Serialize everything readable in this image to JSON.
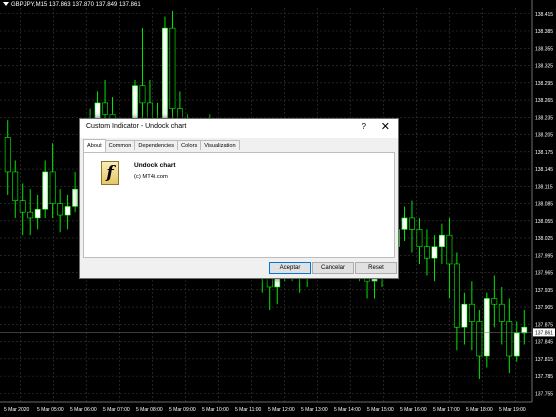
{
  "window": {
    "symbol_info": "GBPJPY,M15  137.863 137.870 137.849 137.861"
  },
  "colors": {
    "bull": "#ffffff",
    "bear": "#000000",
    "wick": "#00ff00",
    "grid": "#3a3a3a",
    "axis_text": "#ffffff",
    "price_tag_bg": "#ffffff",
    "price_tag_text": "#000000"
  },
  "chart_data": {
    "type": "candlestick",
    "symbol": "GBPJPY",
    "timeframe": "M15",
    "price_ticks": [
      "138.415",
      "138.385",
      "138.355",
      "138.325",
      "138.295",
      "138.265",
      "138.235",
      "138.205",
      "138.175",
      "138.145",
      "138.115",
      "138.085",
      "138.055",
      "138.025",
      "137.995",
      "137.965",
      "137.935",
      "137.905",
      "137.875",
      "137.845",
      "137.815",
      "137.785",
      "137.755"
    ],
    "current_price": "137.861",
    "time_ticks": [
      "5 Mar 2020",
      "5 Mar 05:00",
      "5 Mar 06:00",
      "5 Mar 07:00",
      "5 Mar 08:00",
      "5 Mar 09:00",
      "5 Mar 10:00",
      "5 Mar 11:00",
      "5 Mar 12:00",
      "5 Mar 13:00",
      "5 Mar 14:00",
      "5 Mar 15:00",
      "5 Mar 16:00",
      "5 Mar 17:00",
      "5 Mar 18:00",
      "5 Mar 19:00"
    ],
    "ylim": [
      137.74,
      138.425
    ],
    "candles": [
      [
        138.2,
        138.23,
        138.14,
        138.1
      ],
      [
        138.14,
        138.16,
        138.09,
        138.06
      ],
      [
        138.09,
        138.12,
        138.07,
        138.03
      ],
      [
        138.07,
        138.11,
        138.06,
        138.03
      ],
      [
        138.06,
        138.1,
        138.075,
        138.04
      ],
      [
        138.075,
        138.16,
        138.14,
        138.06
      ],
      [
        138.14,
        138.19,
        138.085,
        138.06
      ],
      [
        138.085,
        138.11,
        138.065,
        138.035
      ],
      [
        138.065,
        138.1,
        138.08,
        138.04
      ],
      [
        138.08,
        138.14,
        138.11,
        138.07
      ],
      [
        138.11,
        138.22,
        138.2,
        138.09
      ],
      [
        138.2,
        138.25,
        138.23,
        138.17
      ],
      [
        138.23,
        138.28,
        138.26,
        138.2
      ],
      [
        138.26,
        138.3,
        138.24,
        138.21
      ],
      [
        138.24,
        138.27,
        138.18,
        138.15
      ],
      [
        138.18,
        138.2,
        138.15,
        138.12
      ],
      [
        138.15,
        138.19,
        138.14,
        138.11
      ],
      [
        138.14,
        138.3,
        138.29,
        138.12
      ],
      [
        138.29,
        138.39,
        138.26,
        138.22
      ],
      [
        138.26,
        138.3,
        138.21,
        138.18
      ],
      [
        138.21,
        138.26,
        138.23,
        138.17
      ],
      [
        138.23,
        138.41,
        138.39,
        138.2
      ],
      [
        138.39,
        138.42,
        138.25,
        138.2
      ],
      [
        138.25,
        138.28,
        138.21,
        138.18
      ],
      [
        138.21,
        138.24,
        138.18,
        138.15
      ],
      [
        138.18,
        138.21,
        138.16,
        138.13
      ],
      [
        138.16,
        138.2,
        138.19,
        138.14
      ],
      [
        138.19,
        138.24,
        138.2,
        138.16
      ],
      [
        138.2,
        138.22,
        138.15,
        138.12
      ],
      [
        138.15,
        138.19,
        138.17,
        138.12
      ],
      [
        138.17,
        138.2,
        138.13,
        138.1
      ],
      [
        138.13,
        138.16,
        138.09,
        138.06
      ],
      [
        138.09,
        138.12,
        138.07,
        138.04
      ],
      [
        138.07,
        138.1,
        138.05,
        138.02
      ],
      [
        138.05,
        138.07,
        137.96,
        137.93
      ],
      [
        137.96,
        138.0,
        137.94,
        137.9
      ],
      [
        137.94,
        137.99,
        137.97,
        137.91
      ],
      [
        137.97,
        138.02,
        138.0,
        137.95
      ],
      [
        138.0,
        138.04,
        137.98,
        137.95
      ],
      [
        137.98,
        138.01,
        137.96,
        137.93
      ],
      [
        137.96,
        138.02,
        138.0,
        137.94
      ],
      [
        138.0,
        138.06,
        138.04,
        137.98
      ],
      [
        138.04,
        138.09,
        138.07,
        138.02
      ],
      [
        138.07,
        138.1,
        138.05,
        138.02
      ],
      [
        138.05,
        138.08,
        138.03,
        138.0
      ],
      [
        138.03,
        138.06,
        138.01,
        137.98
      ],
      [
        138.01,
        138.04,
        137.99,
        137.96
      ],
      [
        137.99,
        138.03,
        138.01,
        137.95
      ],
      [
        138.01,
        138.04,
        137.95,
        137.92
      ],
      [
        137.95,
        137.99,
        137.97,
        137.92
      ],
      [
        137.97,
        138.0,
        137.98,
        137.94
      ],
      [
        137.98,
        138.03,
        138.01,
        137.96
      ],
      [
        138.01,
        138.06,
        138.04,
        137.99
      ],
      [
        138.04,
        138.08,
        138.06,
        138.02
      ],
      [
        138.06,
        138.09,
        138.04,
        138.0
      ],
      [
        138.04,
        138.06,
        138.01,
        137.98
      ],
      [
        138.01,
        138.04,
        137.99,
        137.96
      ],
      [
        137.99,
        138.03,
        138.01,
        137.95
      ],
      [
        138.01,
        138.05,
        138.03,
        137.98
      ],
      [
        138.03,
        138.06,
        137.98,
        137.92
      ],
      [
        137.98,
        138.0,
        137.87,
        137.83
      ],
      [
        137.87,
        137.93,
        137.91,
        137.84
      ],
      [
        137.91,
        137.95,
        137.88,
        137.83
      ],
      [
        137.88,
        137.9,
        137.82,
        137.78
      ],
      [
        137.82,
        137.93,
        137.92,
        137.8
      ],
      [
        137.92,
        137.96,
        137.91,
        137.87
      ],
      [
        137.91,
        137.94,
        137.88,
        137.84
      ],
      [
        137.88,
        137.92,
        137.82,
        137.79
      ],
      [
        137.82,
        137.88,
        137.86,
        137.81
      ],
      [
        137.86,
        137.9,
        137.87,
        137.84
      ]
    ]
  },
  "dialog": {
    "title": "Custom Indicator - Undock chart",
    "help": "?",
    "close": "✕",
    "tabs": [
      "About",
      "Common",
      "Dependencies",
      "Colors",
      "Visualization"
    ],
    "indicator_name": "Undock chart",
    "copyright": "(c) MT4i.com",
    "buttons": {
      "ok": "Aceptar",
      "cancel": "Cancelar",
      "reset": "Reset"
    }
  }
}
